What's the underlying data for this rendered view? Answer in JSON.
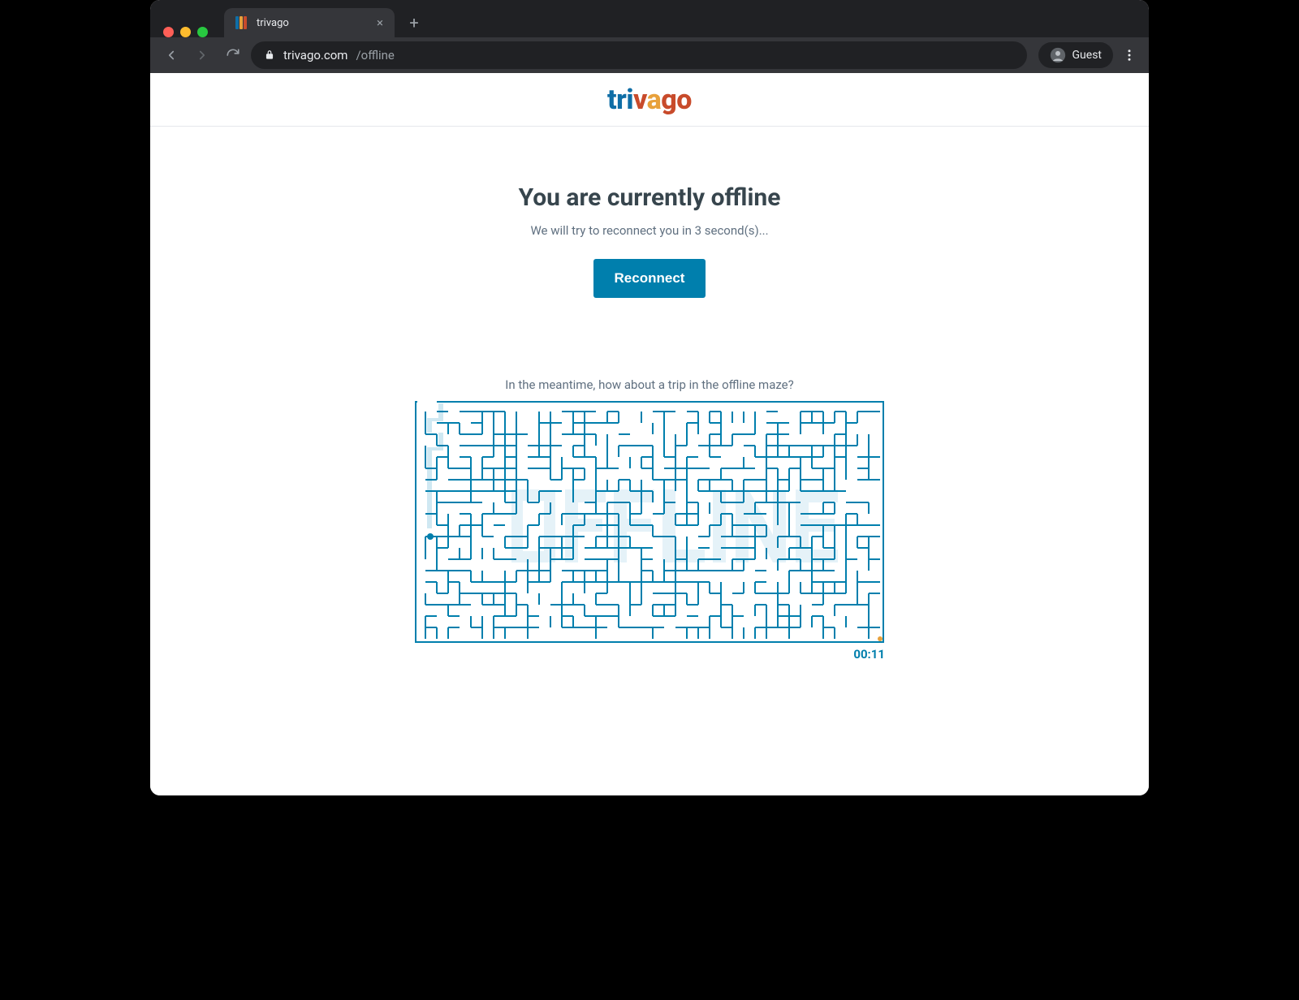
{
  "browser": {
    "tab_title": "trivago",
    "url_host": "trivago.com",
    "url_path": "/offline",
    "guest_label": "Guest",
    "favicon_colors": [
      "#0f6ea6",
      "#e8a13b",
      "#c84b2b"
    ]
  },
  "brand": {
    "name": "trivago",
    "letters": [
      "t",
      "r",
      "i",
      "v",
      "a",
      "g",
      "o"
    ]
  },
  "offline": {
    "headline": "You are currently offline",
    "subline": "We will try to reconnect you in 3 second(s)...",
    "button_label": "Reconnect",
    "maze_hint": "In the meantime, how about a trip in the offline maze?",
    "maze_word": "OFFLINE",
    "maze_timer": "00:11"
  },
  "colors": {
    "accent": "#007fad",
    "chrome_bg": "#202124",
    "chrome_tab": "#35363a"
  }
}
